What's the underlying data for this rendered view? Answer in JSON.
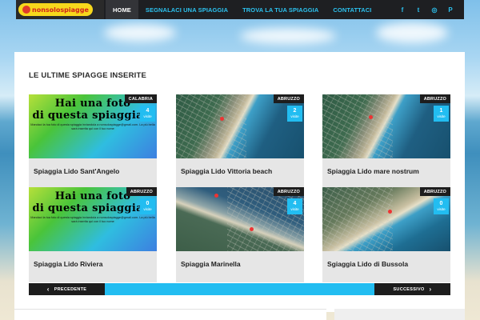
{
  "header": {
    "logo_text": "nonsolospiagge",
    "nav": [
      {
        "label": "HOME",
        "active": true
      },
      {
        "label": "SEGNALACI UNA SPIAGGIA",
        "active": false
      },
      {
        "label": "TROVA LA TUA SPIAGGIA",
        "active": false
      },
      {
        "label": "CONTATTACI",
        "active": false
      }
    ],
    "social": [
      {
        "icon": "facebook-icon",
        "glyph": "f"
      },
      {
        "icon": "twitter-icon",
        "glyph": "t"
      },
      {
        "icon": "instagram-icon",
        "glyph": "◎"
      },
      {
        "icon": "pinterest-icon",
        "glyph": "P"
      }
    ]
  },
  "main": {
    "section_title": "LE ULTIME SPIAGGE INSERITE",
    "promo": {
      "line1": "Hai una foto",
      "line2": "di questa spiaggia ?",
      "small": "Mandaci la tua foto di questa spiaggia inviandola a nonsolospiagge@gmail.com. La più bella sarà inserita qui con il tuo nome"
    },
    "visits_label": "visite",
    "cards": [
      {
        "title": "Spiaggia Lido Sant'Angelo",
        "region": "CALABRIA",
        "visits": "4",
        "image": "promo"
      },
      {
        "title": "Spiaggia Lido Vittoria beach",
        "region": "ABRUZZO",
        "visits": "2",
        "image": "map"
      },
      {
        "title": "Spiaggia Lido mare nostrum",
        "region": "ABRUZZO",
        "visits": "1",
        "image": "map"
      },
      {
        "title": "Spiaggia Lido Riviera",
        "region": "ABRUZZO",
        "visits": "0",
        "image": "promo"
      },
      {
        "title": "Spiaggia Marinella",
        "region": "ABRUZZO",
        "visits": "4",
        "image": "map"
      },
      {
        "title": "Sgiaggia Lido di Bussola",
        "region": "ABRUZZO",
        "visits": "0",
        "image": "map"
      }
    ],
    "pager": {
      "prev": "PRECEDENTE",
      "next": "SUCCESSIVO"
    }
  },
  "colors": {
    "accent": "#22bdf1",
    "dark": "#1d1d1d"
  }
}
